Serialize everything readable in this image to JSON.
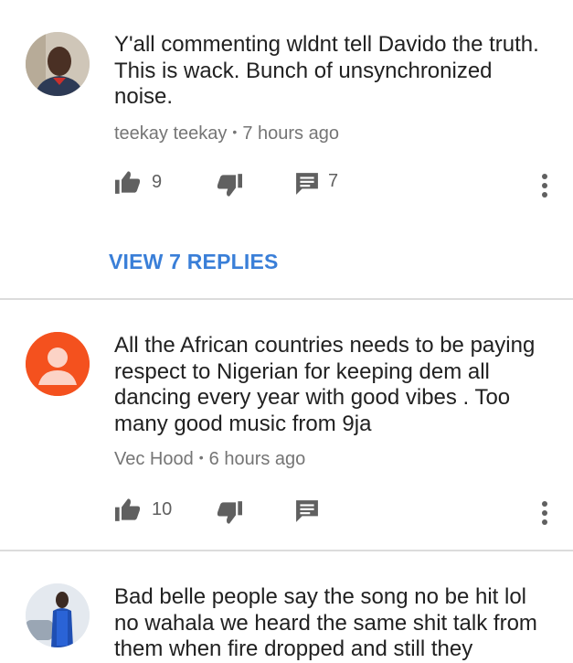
{
  "comments": [
    {
      "avatar_icon": "profile-photo",
      "text": "Y'all commenting wldnt tell Davido the truth. This is wack. Bunch of unsynchronized noise.",
      "author": "teekay teekay",
      "separator": "•",
      "time": "7 hours ago",
      "likes": "9",
      "replies_count": "7",
      "view_replies": "VIEW 7 REPLIES"
    },
    {
      "avatar_icon": "default-user-icon",
      "avatar_color": "#f4511e",
      "text": "All the African countries needs to be paying respect to Nigerian for keeping dem all dancing every year with good vibes . Too many good music from 9ja",
      "author": "Vec Hood",
      "separator": "•",
      "time": "6 hours ago",
      "likes": "10"
    },
    {
      "avatar_icon": "profile-photo",
      "text": "Bad belle people say the song no be hit lol no wahala we heard the same shit talk from them when fire dropped and still they"
    }
  ],
  "colors": {
    "link": "#3a7fd8",
    "icon": "#606060",
    "divider": "#dcdcdc"
  }
}
